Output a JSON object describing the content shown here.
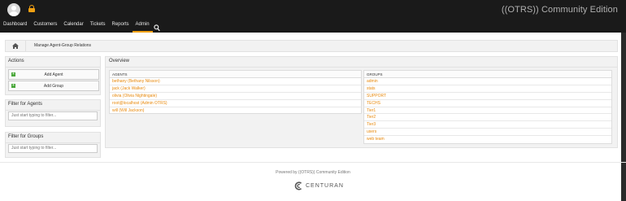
{
  "topbar": {
    "brand": "((OTRS)) Community Edition",
    "nav": [
      "Dashboard",
      "Customers",
      "Calendar",
      "Tickets",
      "Reports",
      "Admin"
    ],
    "active_nav": "Admin"
  },
  "breadcrumb": {
    "title": "Manage Agent-Group Relations"
  },
  "sidebar": {
    "actions_title": "Actions",
    "add_agent": "Add Agent",
    "add_group": "Add Group",
    "filter_agents_title": "Filter for Agents",
    "filter_agents_placeholder": "Just start typing to filter...",
    "filter_groups_title": "Filter for Groups",
    "filter_groups_placeholder": "Just start typing to filter..."
  },
  "overview": {
    "title": "Overview",
    "agents_header": "AGENTS",
    "agents": [
      "bethany (Bethany Nilsson)",
      "jack (Jack Walker)",
      "olivia (Olivia Nightingale)",
      "root@localhost (Admin OTRS)",
      "will (Will Jackson)"
    ],
    "groups_header": "GROUPS",
    "groups": [
      "admin",
      "stats",
      "SUPPORT",
      "TECHS",
      "Tier1",
      "Tier2",
      "Tier3",
      "users",
      "web team"
    ]
  },
  "footer": {
    "powered": "Powered by ((OTRS)) Community Edition",
    "logo_text": "CENTURAN"
  },
  "colors": {
    "accent": "#f0a013",
    "link": "#e8890c",
    "topbar": "#1a1a1a"
  }
}
